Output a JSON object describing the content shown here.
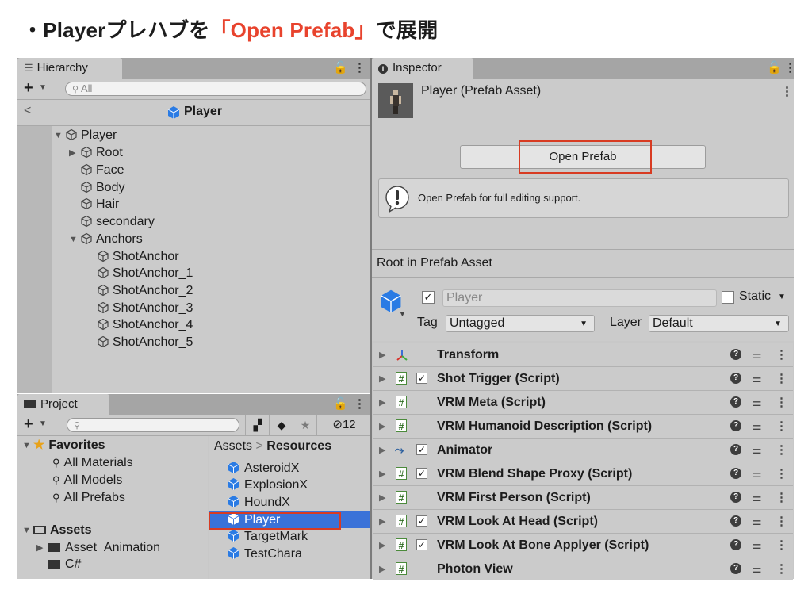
{
  "slide": {
    "bullet": "・",
    "title_prefix": "Playerプレハブを",
    "title_accent": "「Open Prefab」",
    "title_suffix": "で展開"
  },
  "hierarchy": {
    "tab_label": "Hierarchy",
    "search_placeholder": "All",
    "back_glyph": "<",
    "scene_name": "Player",
    "items": [
      {
        "label": "Player"
      },
      {
        "label": "Root"
      },
      {
        "label": "Face"
      },
      {
        "label": "Body"
      },
      {
        "label": "Hair"
      },
      {
        "label": "secondary"
      },
      {
        "label": "Anchors"
      },
      {
        "label": "ShotAnchor"
      },
      {
        "label": "ShotAnchor_1"
      },
      {
        "label": "ShotAnchor_2"
      },
      {
        "label": "ShotAnchor_3"
      },
      {
        "label": "ShotAnchor_4"
      },
      {
        "label": "ShotAnchor_5"
      }
    ]
  },
  "project": {
    "tab_label": "Project",
    "hidden_count": "12",
    "favorites_label": "Favorites",
    "favorites": [
      {
        "label": "All Materials"
      },
      {
        "label": "All Models"
      },
      {
        "label": "All Prefabs"
      }
    ],
    "assets_label": "Assets",
    "folders": [
      {
        "label": "Asset_Animation"
      },
      {
        "label": "C#"
      }
    ],
    "breadcrumb_root": "Assets",
    "breadcrumb_sep": ">",
    "breadcrumb_current": "Resources",
    "assets": [
      {
        "label": "AsteroidX"
      },
      {
        "label": "ExplosionX"
      },
      {
        "label": "HoundX"
      },
      {
        "label": "Player"
      },
      {
        "label": "TargetMark"
      },
      {
        "label": "TestChara"
      }
    ]
  },
  "inspector": {
    "tab_label": "Inspector",
    "asset_title": "Player (Prefab Asset)",
    "open_prefab_label": "Open Prefab",
    "info_message": "Open Prefab for full editing support.",
    "root_label": "Root in Prefab Asset",
    "object_name": "Player",
    "static_label": "Static",
    "tag_label": "Tag",
    "tag_value": "Untagged",
    "layer_label": "Layer",
    "layer_value": "Default",
    "components": [
      {
        "name": "Transform",
        "icon": "transform-icon",
        "checkbox": false
      },
      {
        "name": "Shot Trigger (Script)",
        "icon": "script-icon",
        "checkbox": true
      },
      {
        "name": "VRM Meta (Script)",
        "icon": "script-icon",
        "checkbox": false
      },
      {
        "name": "VRM Humanoid Description (Script)",
        "icon": "script-icon",
        "checkbox": false
      },
      {
        "name": "Animator",
        "icon": "animator-icon",
        "checkbox": true
      },
      {
        "name": "VRM Blend Shape Proxy (Script)",
        "icon": "script-icon",
        "checkbox": true
      },
      {
        "name": "VRM First Person (Script)",
        "icon": "script-icon",
        "checkbox": false
      },
      {
        "name": "VRM Look At Head (Script)",
        "icon": "script-icon",
        "checkbox": true
      },
      {
        "name": "VRM Look At Bone Applyer (Script)",
        "icon": "script-icon",
        "checkbox": true
      },
      {
        "name": "Photon View",
        "icon": "script-icon",
        "checkbox": false
      }
    ]
  },
  "colors": {
    "accent_red": "#e8432d",
    "highlight_box": "#d83b22",
    "selection_blue": "#3a72d8",
    "prefab_blue": "#2a7be4"
  }
}
